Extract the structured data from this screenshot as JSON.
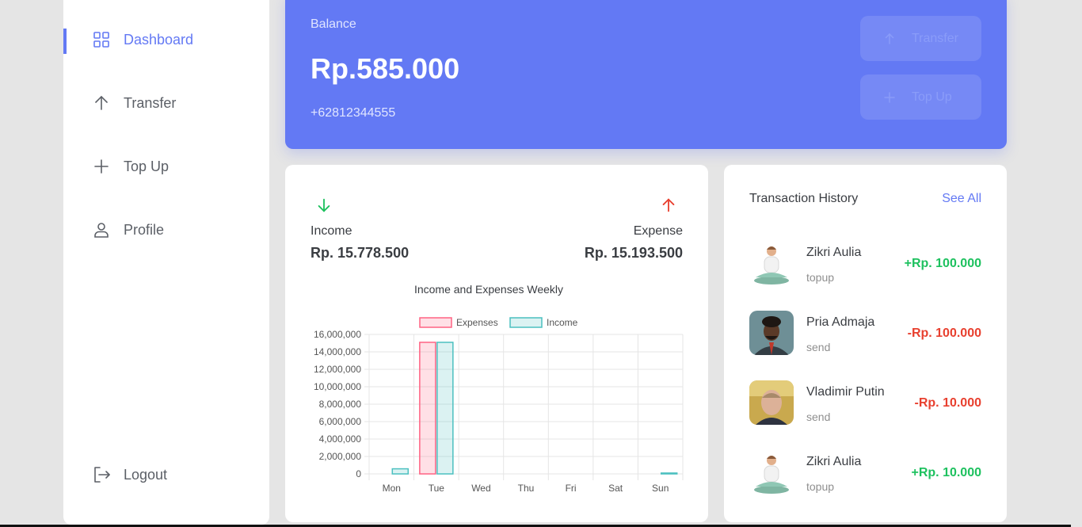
{
  "sidebar": {
    "items": [
      {
        "label": "Dashboard",
        "icon": "grid-icon",
        "active": true
      },
      {
        "label": "Transfer",
        "icon": "arrow-up-icon",
        "active": false
      },
      {
        "label": "Top Up",
        "icon": "plus-icon",
        "active": false
      },
      {
        "label": "Profile",
        "icon": "user-icon",
        "active": false
      }
    ],
    "logout": {
      "label": "Logout",
      "icon": "logout-icon"
    }
  },
  "balance": {
    "label": "Balance",
    "amount": "Rp.585.000",
    "phone": "+62812344555",
    "transfer_label": "Transfer",
    "topup_label": "Top Up"
  },
  "stats": {
    "income_label": "Income",
    "income_value": "Rp. 15.778.500",
    "expense_label": "Expense",
    "expense_value": "Rp. 15.193.500"
  },
  "chart_data": {
    "type": "bar",
    "title": "Income and Expenses Weekly",
    "xlabel": "",
    "ylabel": "",
    "categories": [
      "Mon",
      "Tue",
      "Wed",
      "Thu",
      "Fri",
      "Sat",
      "Sun"
    ],
    "series": [
      {
        "name": "Expenses",
        "values": [
          0,
          15093500,
          0,
          0,
          0,
          0,
          0
        ],
        "color": "#ff6384"
      },
      {
        "name": "Income",
        "values": [
          585000,
          15093500,
          0,
          0,
          0,
          0,
          100000
        ],
        "color": "#4bc0c0"
      }
    ],
    "ylim": [
      0,
      16000000
    ],
    "yticks": [
      "16,000,000",
      "14,000,000",
      "12,000,000",
      "10,000,000",
      "8,000,000",
      "6,000,000",
      "4,000,000",
      "2,000,000",
      "0"
    ],
    "grid": true,
    "legend": "top"
  },
  "history": {
    "title": "Transaction History",
    "see_all": "See All",
    "items": [
      {
        "name": "Zikri Aulia",
        "type": "topup",
        "amount": "+Rp. 100.000",
        "direction": "in"
      },
      {
        "name": "Pria Admaja",
        "type": "send",
        "amount": "-Rp. 100.000",
        "direction": "out"
      },
      {
        "name": "Vladimir Putin",
        "type": "send",
        "amount": "-Rp. 10.000",
        "direction": "out"
      },
      {
        "name": "Zikri Aulia",
        "type": "topup",
        "amount": "+Rp. 10.000",
        "direction": "in"
      }
    ]
  },
  "colors": {
    "primary": "#6379f4",
    "positive": "#1ec15f",
    "negative": "#e8402f"
  }
}
